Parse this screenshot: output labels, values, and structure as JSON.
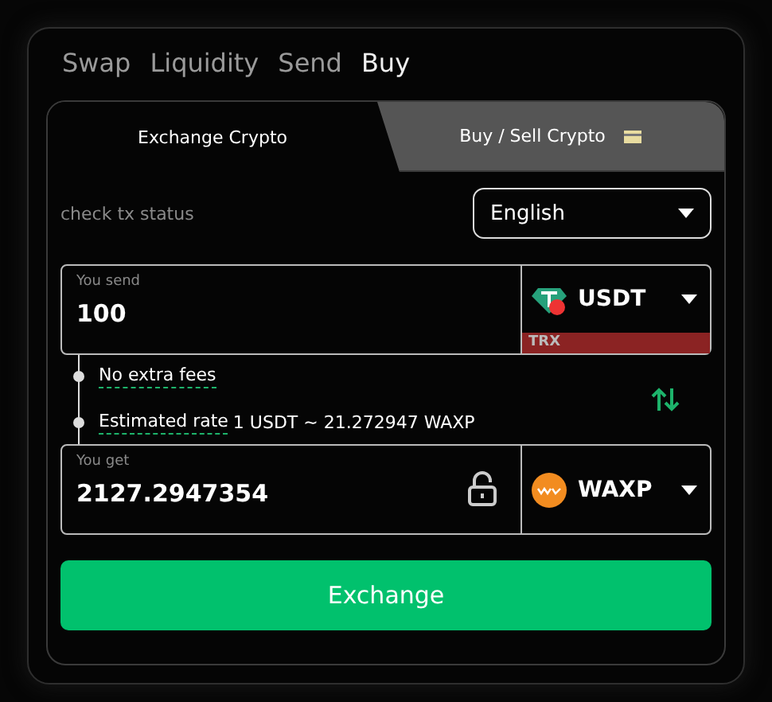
{
  "nav": [
    {
      "label": "Swap",
      "selected": false
    },
    {
      "label": "Liquidity",
      "selected": false
    },
    {
      "label": "Send",
      "selected": false
    },
    {
      "label": "Buy",
      "selected": true
    }
  ],
  "tabs": [
    {
      "label": "Exchange Crypto",
      "selected": true
    },
    {
      "label": "Buy / Sell Crypto",
      "selected": false
    }
  ],
  "status_link": "check tx status",
  "language": {
    "value": "English"
  },
  "send": {
    "label": "You send",
    "value": "100",
    "token": {
      "kind": "tether",
      "symbol": "USDT",
      "network": "TRX"
    }
  },
  "info": [
    {
      "text": "No extra fees"
    },
    {
      "text": "Estimated rate",
      "detail": "1 USDT ~ 21.272947 WAXP"
    }
  ],
  "get": {
    "label": "You get",
    "value": "2127.2947354",
    "locked": false,
    "token": {
      "kind": "wax",
      "symbol": "WAXP"
    }
  },
  "button": "Exchange"
}
